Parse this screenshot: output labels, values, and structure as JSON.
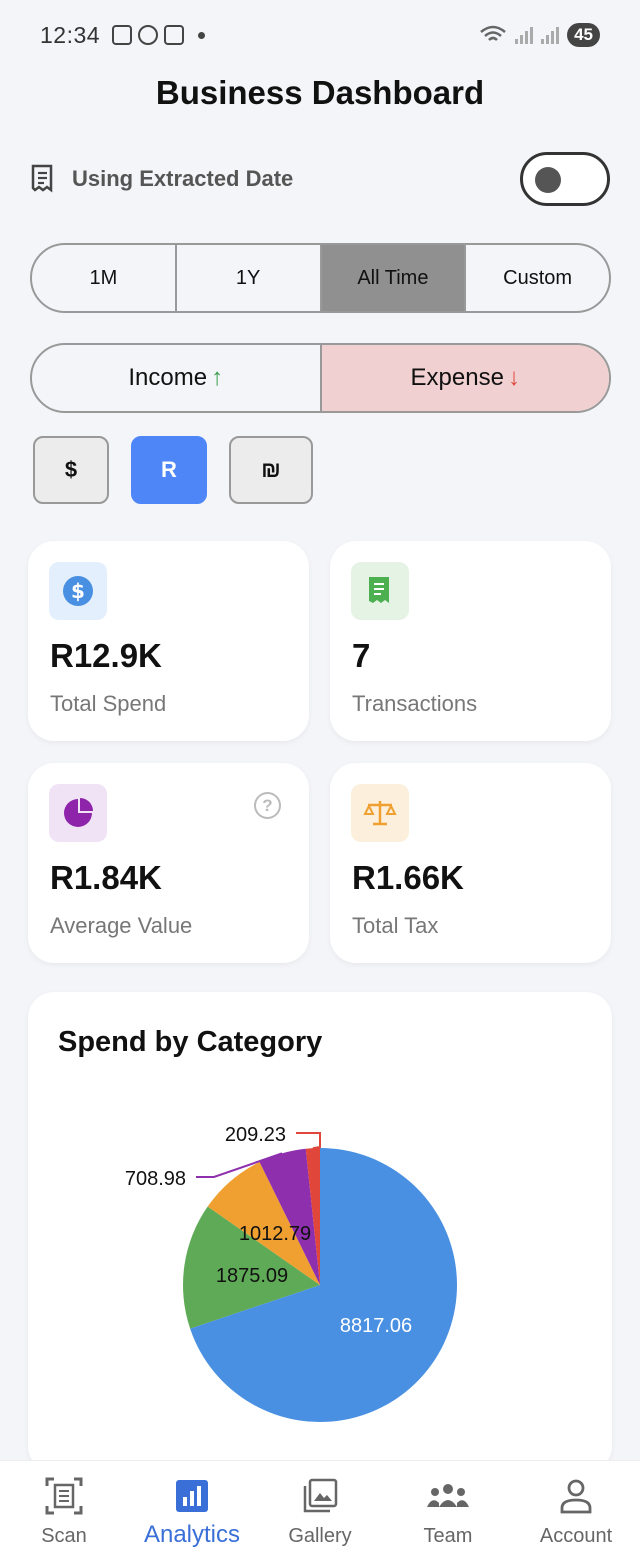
{
  "status_bar": {
    "time": "12:34",
    "battery": "45"
  },
  "header": {
    "title": "Business Dashboard"
  },
  "date_toggle": {
    "label": "Using Extracted Date",
    "enabled": false
  },
  "period_tabs": [
    {
      "label": "1M",
      "active": false
    },
    {
      "label": "1Y",
      "active": false
    },
    {
      "label": "All Time",
      "active": true
    },
    {
      "label": "Custom",
      "active": false
    }
  ],
  "type_tabs": {
    "income": {
      "label": "Income",
      "arrow": "↑"
    },
    "expense": {
      "label": "Expense",
      "arrow": "↓",
      "active": true
    }
  },
  "currencies": [
    {
      "label": "$",
      "active": false
    },
    {
      "label": "R",
      "active": true
    },
    {
      "label": "₪",
      "active": false
    }
  ],
  "stats": {
    "total_spend": {
      "value": "R12.9K",
      "label": "Total Spend",
      "icon": "dollar-icon",
      "color": "#4a90e2"
    },
    "transactions": {
      "value": "7",
      "label": "Transactions",
      "icon": "receipt-icon",
      "color": "#4caf50"
    },
    "average_value": {
      "value": "R1.84K",
      "label": "Average Value",
      "icon": "pie-chart-icon",
      "color": "#8e24aa",
      "help": "?"
    },
    "total_tax": {
      "value": "R1.66K",
      "label": "Total Tax",
      "icon": "scales-icon",
      "color": "#f0a030"
    }
  },
  "chart_data": {
    "type": "pie",
    "title": "Spend by Category",
    "slices": [
      {
        "label": "8817.06",
        "value": 8817.06,
        "color": "#4a90e2"
      },
      {
        "label": "1875.09",
        "value": 1875.09,
        "color": "#5faa57"
      },
      {
        "label": "1012.79",
        "value": 1012.79,
        "color": "#f0a030"
      },
      {
        "label": "708.98",
        "value": 708.98,
        "color": "#8e2fae"
      },
      {
        "label": "209.23",
        "value": 209.23,
        "color": "#e0463a"
      }
    ]
  },
  "bottom_nav": [
    {
      "label": "Scan",
      "icon": "scan-icon",
      "active": false
    },
    {
      "label": "Analytics",
      "icon": "analytics-icon",
      "active": true
    },
    {
      "label": "Gallery",
      "icon": "gallery-icon",
      "active": false
    },
    {
      "label": "Team",
      "icon": "team-icon",
      "active": false
    },
    {
      "label": "Account",
      "icon": "account-icon",
      "active": false
    }
  ]
}
